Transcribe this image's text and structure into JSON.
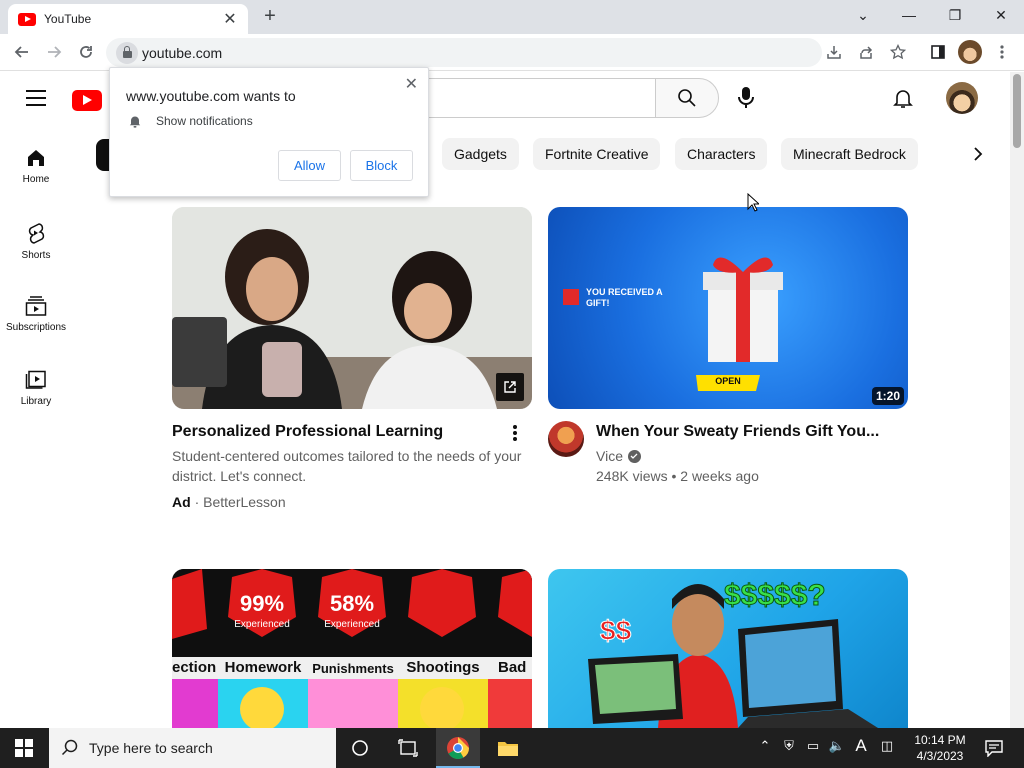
{
  "browser": {
    "tab_title": "YouTube",
    "tab_close": "✕",
    "new_tab": "+",
    "url": "youtube.com",
    "win_min": "—",
    "win_restore": "❐",
    "win_close": "✕",
    "win_tabsearch": "⌄"
  },
  "popup": {
    "title": "www.youtube.com wants to",
    "permission": "Show notifications",
    "allow": "Allow",
    "block": "Block",
    "close": "✕"
  },
  "nav": [
    {
      "label": "Home"
    },
    {
      "label": "Shorts"
    },
    {
      "label": "Subscriptions"
    },
    {
      "label": "Library"
    }
  ],
  "chips": [
    "Gadgets",
    "Fortnite Creative",
    "Characters",
    "Minecraft Bedrock"
  ],
  "videos": [
    {
      "title": "Personalized Professional Learning",
      "description": "Student-centered outcomes tailored to the needs of your district. Let's connect.",
      "ad_label": "Ad",
      "sponsor": "BetterLesson"
    },
    {
      "title": "When Your Sweaty Friends Gift You...",
      "channel": "Vice",
      "stats": "248K views • 2 weeks ago",
      "duration": "1:20",
      "thumb_text_1": "YOU RECEIVED A GIFT!",
      "thumb_button": "OPEN"
    },
    {
      "thumb_pct_1": "99%",
      "thumb_pct_2": "58%",
      "thumb_sub": "Experienced",
      "thumb_labels": [
        "ection",
        "Homework",
        "Punishments",
        "Shootings",
        "Bad"
      ]
    },
    {
      "thumb_text": "$$$$$?",
      "thumb_text_2": "$$"
    }
  ],
  "taskbar": {
    "search_placeholder": "Type here to search",
    "time": "10:14 PM",
    "date": "4/3/2023",
    "lang": "A"
  },
  "colors": {
    "yt_red": "#ff0000",
    "link_blue": "#1a73e8",
    "chip_bg": "#f2f2f2"
  }
}
